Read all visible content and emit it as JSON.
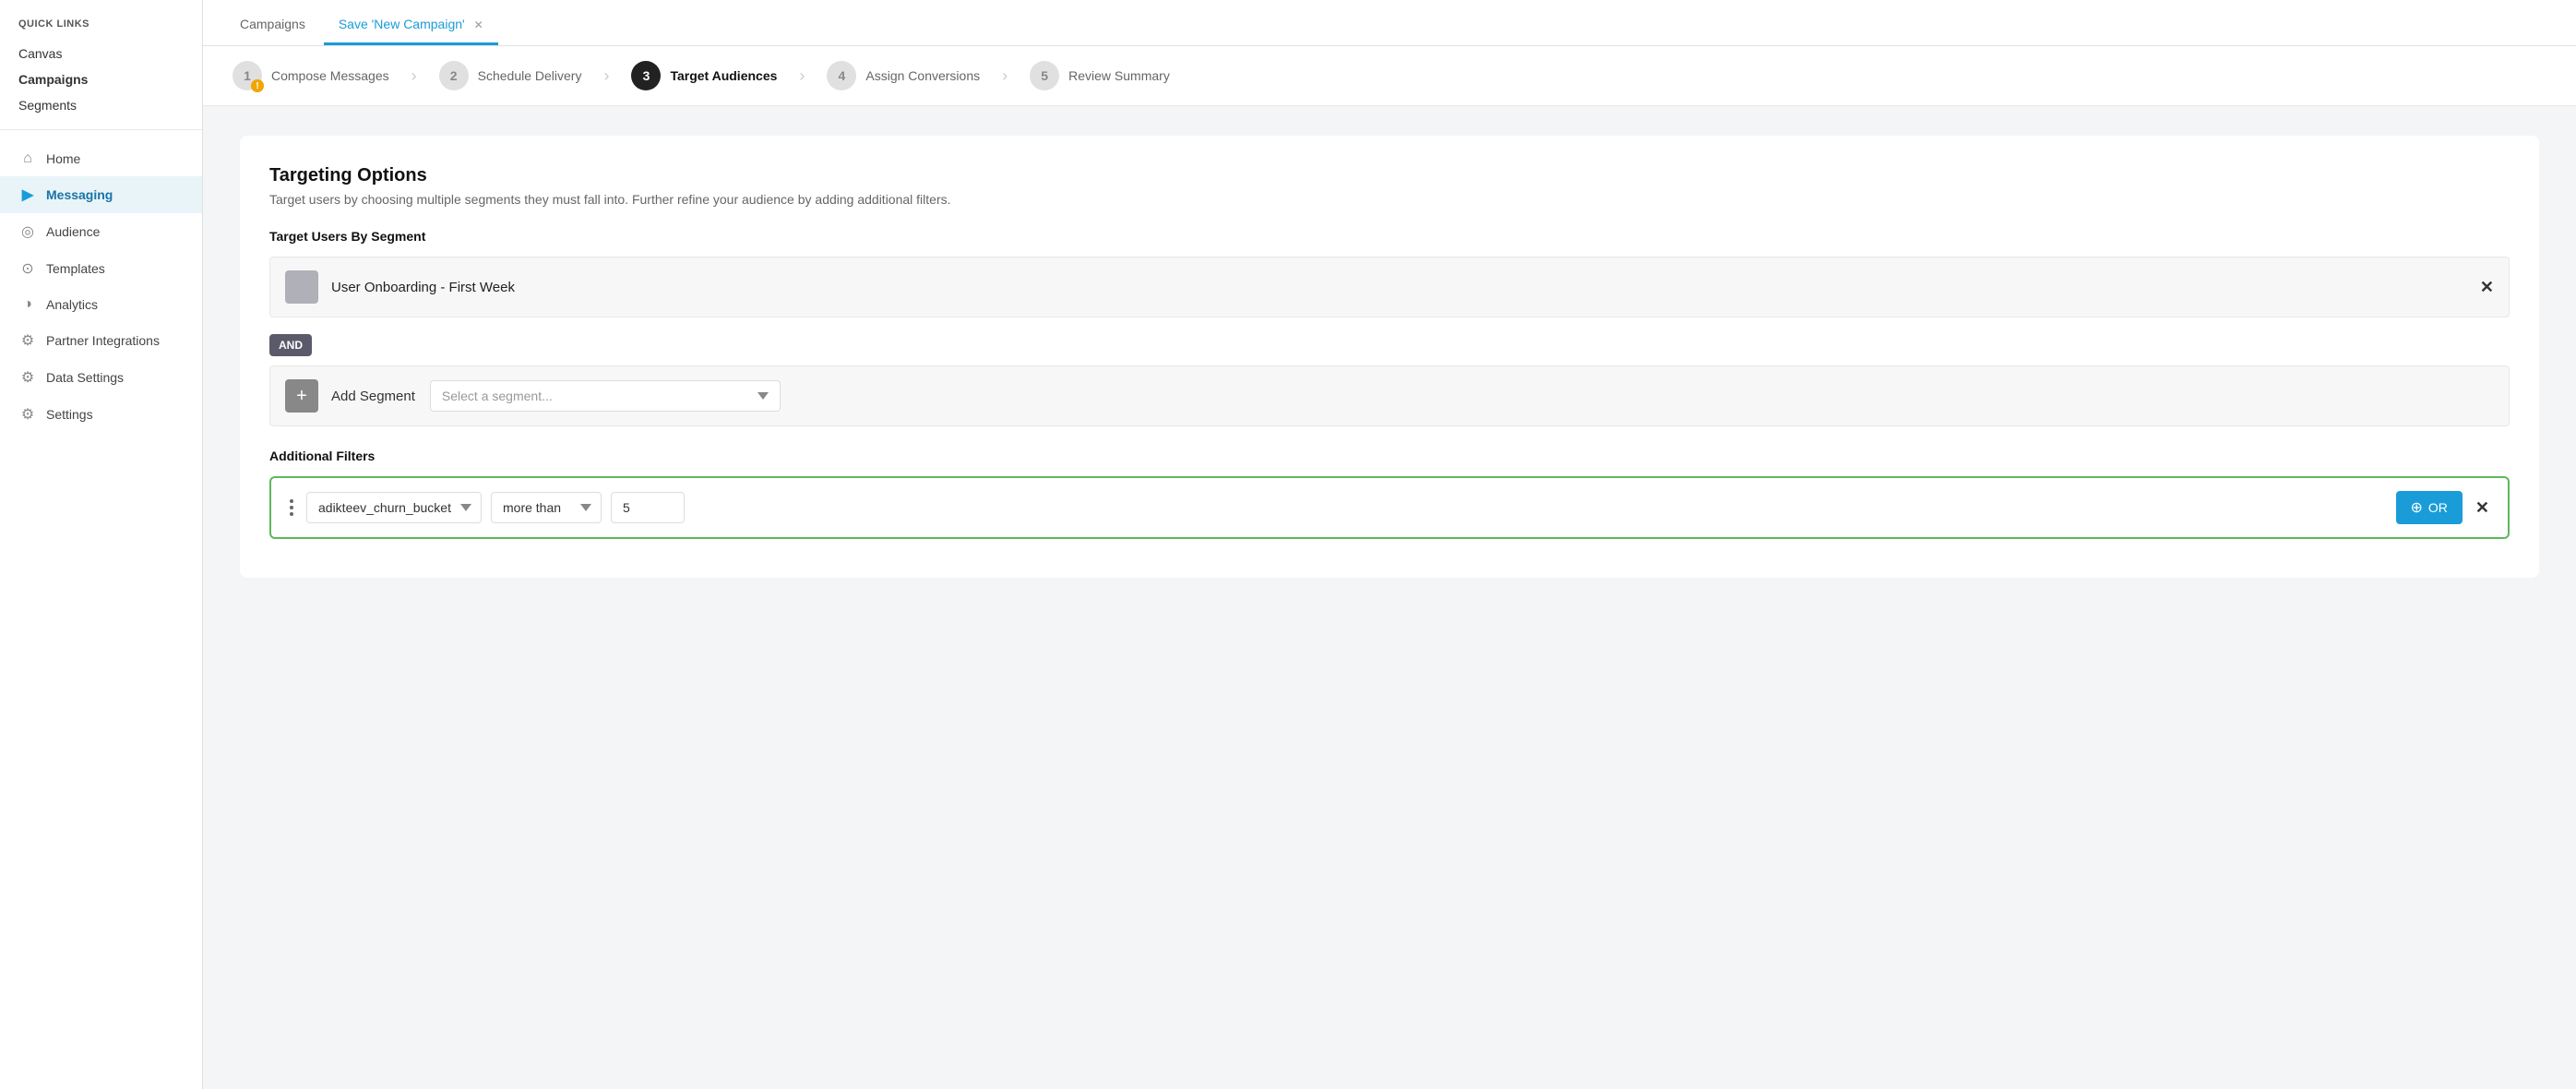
{
  "sidebar": {
    "quick_links_label": "QUICK LINKS",
    "links": [
      {
        "id": "canvas",
        "label": "Canvas",
        "bold": false
      },
      {
        "id": "campaigns",
        "label": "Campaigns",
        "bold": true
      },
      {
        "id": "segments",
        "label": "Segments",
        "bold": false
      }
    ],
    "nav_items": [
      {
        "id": "home",
        "label": "Home",
        "icon": "⌂",
        "active": false
      },
      {
        "id": "messaging",
        "label": "Messaging",
        "icon": "▶",
        "active": true
      },
      {
        "id": "audience",
        "label": "Audience",
        "icon": "◎",
        "active": false
      },
      {
        "id": "templates",
        "label": "Templates",
        "icon": "⊙",
        "active": false
      },
      {
        "id": "analytics",
        "label": "Analytics",
        "icon": "◑",
        "active": false
      },
      {
        "id": "partner-integrations",
        "label": "Partner Integrations",
        "icon": "⚙",
        "active": false
      },
      {
        "id": "data-settings",
        "label": "Data Settings",
        "icon": "⚙",
        "active": false
      },
      {
        "id": "settings",
        "label": "Settings",
        "icon": "⚙",
        "active": false
      }
    ]
  },
  "tabs": [
    {
      "id": "campaigns",
      "label": "Campaigns",
      "active": false,
      "closeable": false
    },
    {
      "id": "new-campaign",
      "label": "Save 'New Campaign'",
      "active": true,
      "closeable": true
    }
  ],
  "steps": [
    {
      "id": "compose",
      "number": "1",
      "label": "Compose Messages",
      "state": "warning"
    },
    {
      "id": "schedule",
      "number": "2",
      "label": "Schedule Delivery",
      "state": "inactive"
    },
    {
      "id": "target",
      "number": "3",
      "label": "Target Audiences",
      "state": "active"
    },
    {
      "id": "conversions",
      "number": "4",
      "label": "Assign Conversions",
      "state": "inactive"
    },
    {
      "id": "review",
      "number": "5",
      "label": "Review Summary",
      "state": "inactive"
    }
  ],
  "targeting": {
    "title": "Targeting Options",
    "description": "Target users by choosing multiple segments they must fall into. Further refine your audience by adding additional filters.",
    "segment_section_title": "Target Users By Segment",
    "existing_segment": "User Onboarding - First Week",
    "and_label": "AND",
    "add_segment_label": "Add Segment",
    "select_placeholder": "Select a segment...",
    "filters_section_title": "Additional Filters",
    "filter": {
      "attribute": "adikteev_churn_bucket",
      "operator": "more than",
      "value": "5"
    },
    "or_button_label": "+ OR",
    "close_symbol": "✕"
  }
}
